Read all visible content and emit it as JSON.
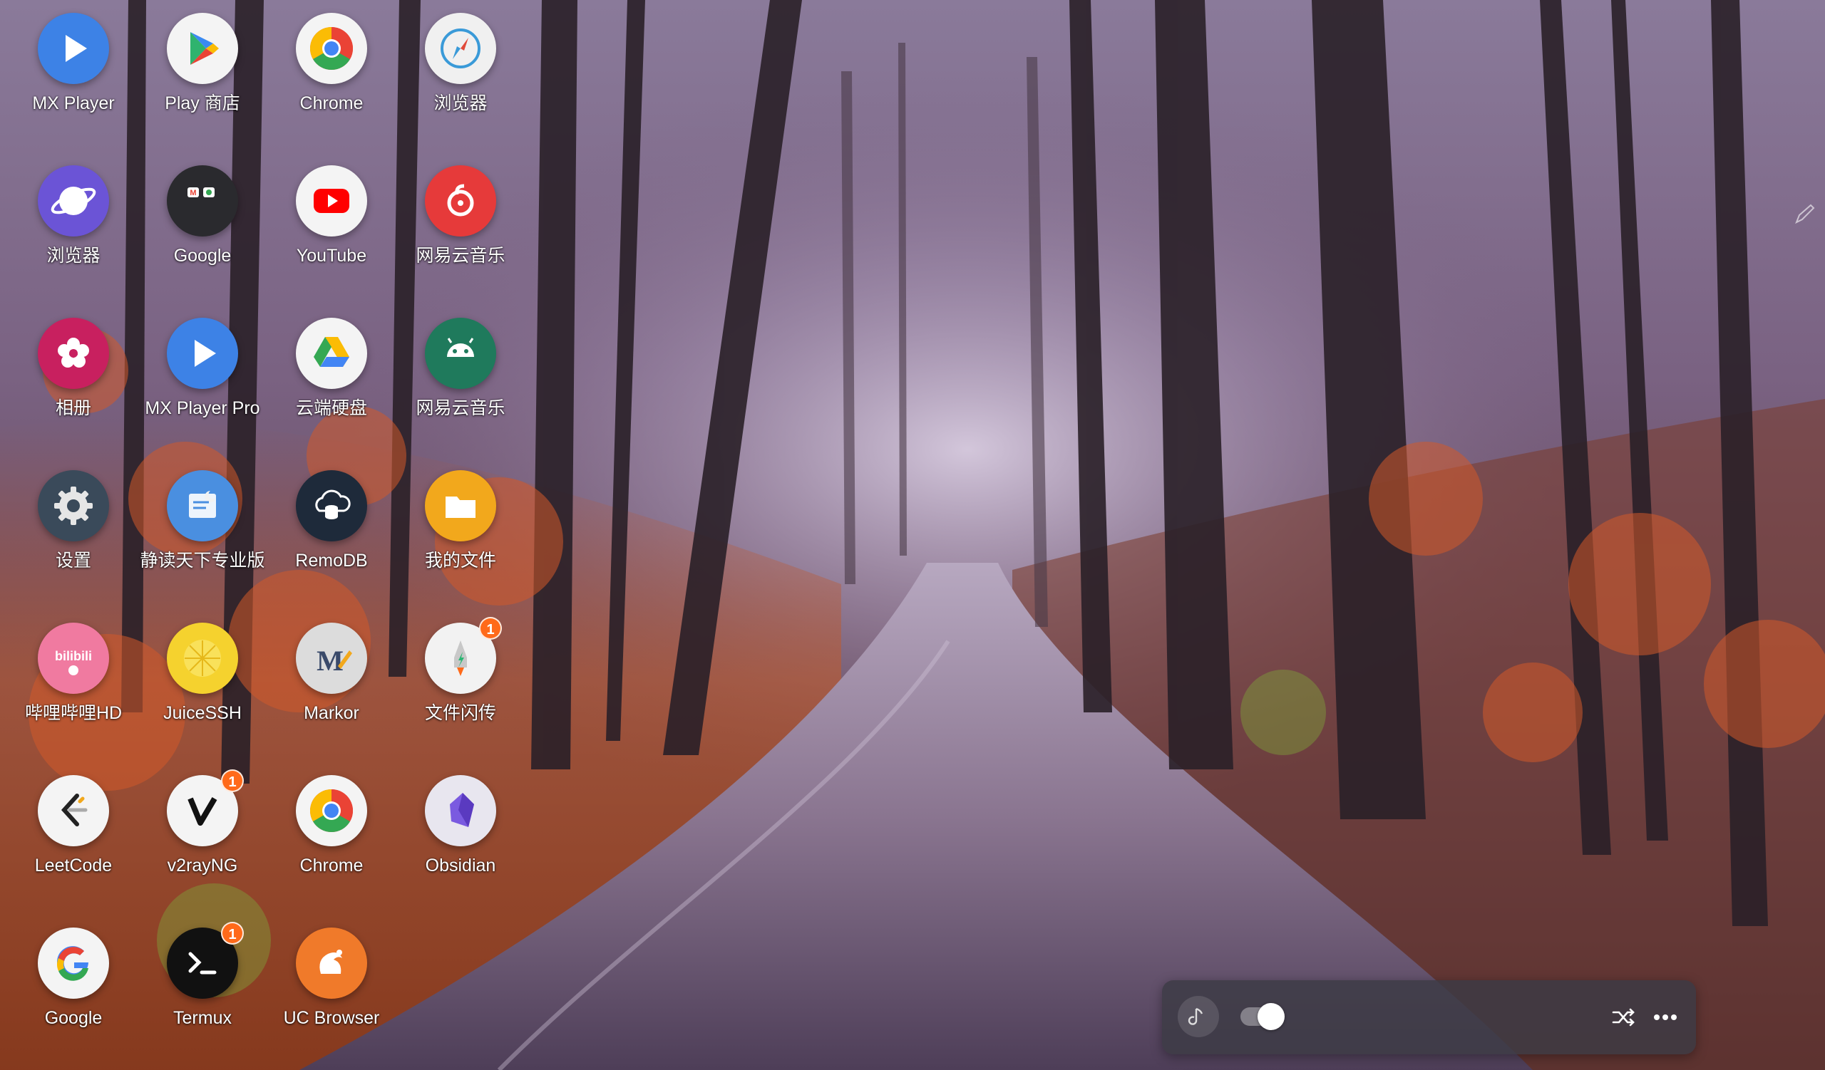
{
  "wallpaper": {
    "description_icon": "forest-road-wallpaper"
  },
  "apps": [
    {
      "label": "MX Player",
      "icon": "mx-player-icon",
      "color": "#3d82e6"
    },
    {
      "label": "Play 商店",
      "icon": "play-store-icon",
      "color": "#f4f4f4"
    },
    {
      "label": "Chrome",
      "icon": "chrome-icon",
      "color": "#f4f4f4"
    },
    {
      "label": "浏览器",
      "icon": "compass-browser-icon",
      "color": "#f0f0f0"
    },
    {
      "label": "浏览器",
      "icon": "samsung-internet-icon",
      "color": "#6b54d6"
    },
    {
      "label": "Google",
      "icon": "google-folder-icon",
      "color": "#2a2a2e"
    },
    {
      "label": "YouTube",
      "icon": "youtube-icon",
      "color": "#f4f4f4"
    },
    {
      "label": "网易云音乐",
      "icon": "netease-music-icon",
      "color": "#e63a3a"
    },
    {
      "label": "相册",
      "icon": "gallery-flower-icon",
      "color": "#c8205f"
    },
    {
      "label": "MX Player Pro",
      "icon": "mx-player-pro-icon",
      "color": "#3d82e6"
    },
    {
      "label": "云端硬盘",
      "icon": "google-drive-icon",
      "color": "#f4f4f4"
    },
    {
      "label": "网易云音乐",
      "icon": "android-netease-icon",
      "color": "#1f7a5c"
    },
    {
      "label": "设置",
      "icon": "settings-gear-icon",
      "color": "#3a4a5a"
    },
    {
      "label": "静读天下专业版",
      "icon": "moon-reader-icon",
      "color": "#4a8fe0"
    },
    {
      "label": "RemoDB",
      "icon": "remodb-cloud-icon",
      "color": "#1e2a3a"
    },
    {
      "label": "我的文件",
      "icon": "my-files-folder-icon",
      "color": "#f2a81c"
    },
    {
      "label": "哔哩哔哩HD",
      "icon": "bilibili-icon",
      "color": "#f07aa0"
    },
    {
      "label": "JuiceSSH",
      "icon": "juicessh-lemon-icon",
      "color": "#f5d22e"
    },
    {
      "label": "Markor",
      "icon": "markor-icon",
      "color": "#dcdcdc"
    },
    {
      "label": "文件闪传",
      "icon": "file-transfer-rocket-icon",
      "color": "#f2f2f2",
      "badge": "1"
    },
    {
      "label": "LeetCode",
      "icon": "leetcode-icon",
      "color": "#f4f4f4"
    },
    {
      "label": "v2rayNG",
      "icon": "v2rayng-icon",
      "color": "#f4f4f4",
      "badge": "1"
    },
    {
      "label": "Chrome",
      "icon": "chrome-icon",
      "color": "#f4f4f4"
    },
    {
      "label": "Obsidian",
      "icon": "obsidian-crystal-icon",
      "color": "#e8e6ef"
    },
    {
      "label": "Google",
      "icon": "google-g-icon",
      "color": "#f4f4f4"
    },
    {
      "label": "Termux",
      "icon": "termux-terminal-icon",
      "color": "#111111",
      "badge": "1"
    },
    {
      "label": "UC Browser",
      "icon": "uc-browser-squirrel-icon",
      "color": "#f07a2a"
    }
  ],
  "music_widget": {
    "note_icon": "music-note-icon",
    "toggle_state": "on",
    "shuffle_icon": "shuffle-icon",
    "more_icon": "more-dots-icon"
  },
  "edit_handle_icon": "pencil-edit-icon"
}
